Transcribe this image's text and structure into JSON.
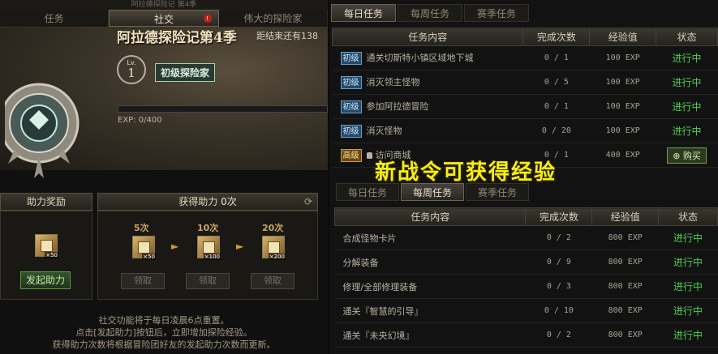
{
  "left": {
    "top_strip": "阿拉德探险记 第4季",
    "tabs": [
      {
        "label": "任务"
      },
      {
        "label": "社交",
        "badge": "!"
      },
      {
        "label": "伟大的探险家"
      }
    ],
    "season": {
      "title": "阿拉德探险记第4季",
      "remain": "距结束还有138",
      "level_prefix": "Lv.",
      "level": "1",
      "rank": "初级探险家",
      "exp_label": "EXP:",
      "exp_value": "0/400",
      "exp_progress": 0.0
    },
    "assist": {
      "reward_header": "助力奖励",
      "reward_item_count": "×50",
      "launch_button": "发起助力",
      "gain_header_prefix": "获得助力",
      "gain_count": "0次",
      "tiers": [
        {
          "label": "5次",
          "count": "×50",
          "claim": "领取"
        },
        {
          "label": "10次",
          "count": "×100",
          "claim": "领取"
        },
        {
          "label": "20次",
          "count": "×200",
          "claim": "领取"
        }
      ]
    },
    "notice": [
      "社交功能将于每日凌晨6点重置。",
      "点击[发起助力]按钮后，立即增加探险经验。",
      "获得助力次数将根据冒险团好友的发起助力次数而更新。"
    ]
  },
  "right": {
    "tabs_top": [
      "每日任务",
      "每周任务",
      "赛季任务"
    ],
    "tabs_bottom": [
      "每日任务",
      "每周任务",
      "赛季任务"
    ],
    "columns": [
      "任务内容",
      "完成次数",
      "经验值",
      "状态"
    ],
    "daily": [
      {
        "grade": "初级",
        "name": "通关切斯特小镇区域地下城",
        "progress": "0 / 1",
        "exp": "100 EXP",
        "status": "进行中"
      },
      {
        "grade": "初级",
        "name": "消灭领主怪物",
        "progress": "0 / 5",
        "exp": "100 EXP",
        "status": "进行中"
      },
      {
        "grade": "初级",
        "name": "参加阿拉德冒险",
        "progress": "0 / 1",
        "exp": "100 EXP",
        "status": "进行中"
      },
      {
        "grade": "初级",
        "name": "消灭怪物",
        "progress": "0 / 20",
        "exp": "100 EXP",
        "status": "进行中"
      },
      {
        "grade": "高级",
        "name": "访问商城",
        "progress": "0 / 1",
        "exp": "400 EXP",
        "status": "购买",
        "locked": true
      }
    ],
    "weekly": [
      {
        "name": "合成怪物卡片",
        "progress": "0 / 2",
        "exp": "800 EXP",
        "status": "进行中"
      },
      {
        "name": "分解装备",
        "progress": "0 / 9",
        "exp": "800 EXP",
        "status": "进行中"
      },
      {
        "name": "修理/全部修理装备",
        "progress": "0 / 3",
        "exp": "800 EXP",
        "status": "进行中"
      },
      {
        "name": "通关『智慧的引导』",
        "progress": "0 / 10",
        "exp": "800 EXP",
        "status": "进行中"
      },
      {
        "name": "通关『未央幻境』",
        "progress": "0 / 2",
        "exp": "800 EXP",
        "status": "进行中"
      }
    ]
  },
  "overlay_text": "新战令可获得经验",
  "colors": {
    "status_green": "#4fd04f",
    "overlay_yellow": "#f6ee14",
    "grade_low": "#254a6a",
    "grade_high": "#6a4a14"
  }
}
